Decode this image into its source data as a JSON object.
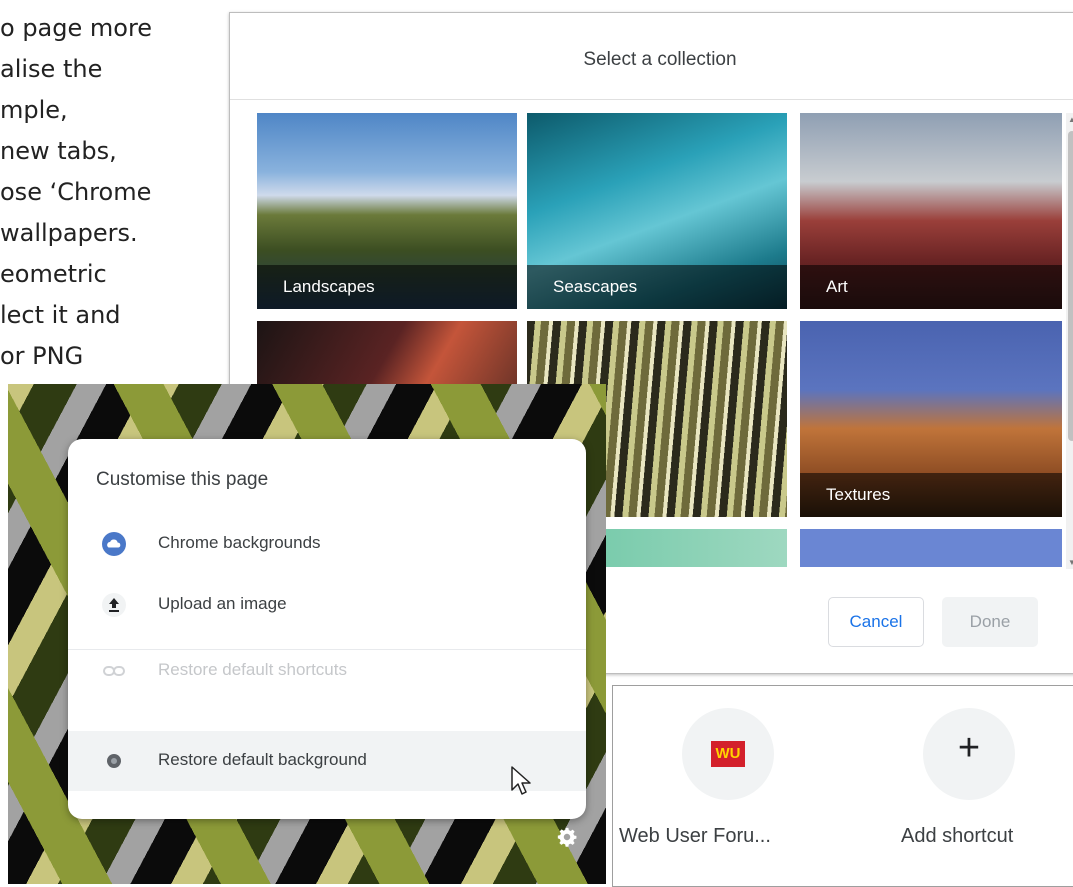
{
  "article": {
    "lines": [
      "o page more",
      "alise the",
      "mple,",
      "new tabs,",
      "ose ‘Chrome",
      "wallpapers.",
      "eometric",
      "lect it and",
      "or PNG"
    ]
  },
  "dialog": {
    "title": "Select a collection",
    "collections": [
      {
        "label": "Landscapes"
      },
      {
        "label": "Seascapes"
      },
      {
        "label": "Art"
      },
      {
        "label": ""
      },
      {
        "label": ""
      },
      {
        "label": "Textures"
      }
    ],
    "cancel_label": "Cancel",
    "done_label": "Done"
  },
  "customise_menu": {
    "title": "Customise this page",
    "items": [
      {
        "label": "Chrome backgrounds",
        "icon": "cloud-icon",
        "enabled": true
      },
      {
        "label": "Upload an image",
        "icon": "upload-icon",
        "enabled": true
      },
      {
        "label": "Restore default shortcuts",
        "icon": "link-icon",
        "enabled": false
      },
      {
        "label": "Restore default background",
        "icon": "circle-icon",
        "enabled": true
      }
    ]
  },
  "shortcuts": {
    "items": [
      {
        "label": "Web User Foru...",
        "icon_text": "WU"
      },
      {
        "label": "Add shortcut",
        "icon_text": "+"
      }
    ]
  },
  "colors": {
    "accent_blue": "#1a73e8",
    "wu_red": "#d3202b",
    "wu_yellow": "#ffd400"
  }
}
